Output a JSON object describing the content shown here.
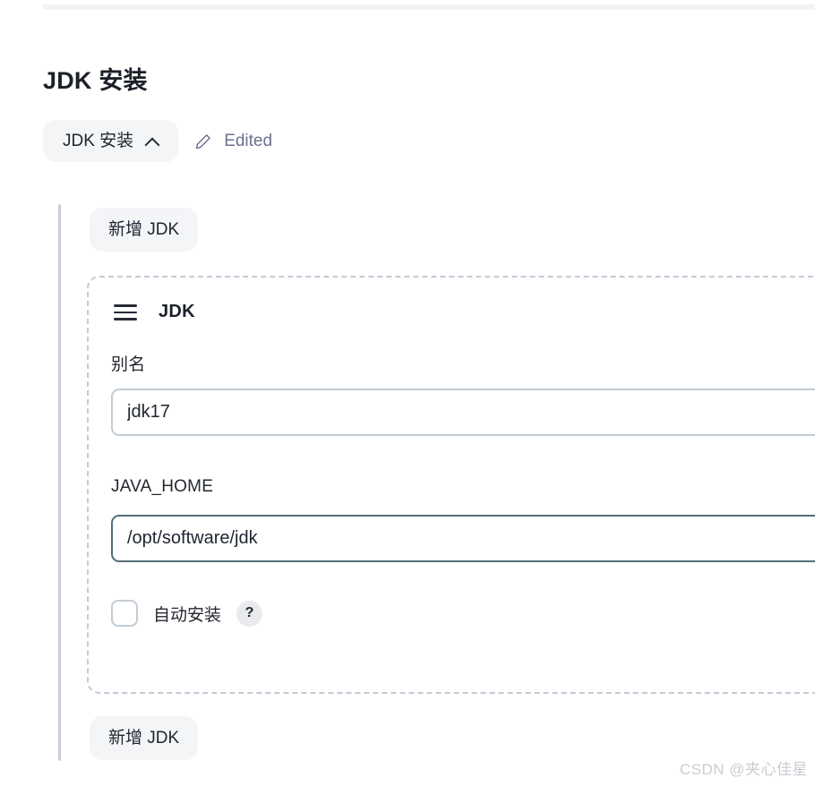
{
  "page": {
    "title": "JDK 安装"
  },
  "collapse": {
    "label": "JDK 安装",
    "chevron_icon": "chevron-up-icon",
    "edited_label": "Edited",
    "edit_icon": "pencil-icon"
  },
  "buttons": {
    "add_jdk_top": "新增 JDK",
    "add_jdk_bottom": "新增 JDK"
  },
  "card": {
    "drag_icon": "hamburger-drag-icon",
    "title": "JDK",
    "fields": [
      {
        "label": "别名",
        "value": "jdk17",
        "placeholder": "",
        "state": "idle"
      },
      {
        "label": "JAVA_HOME",
        "value": "/opt/software/jdk",
        "placeholder": "",
        "state": "focused"
      }
    ],
    "checkbox": {
      "label": "自动安装",
      "checked": false,
      "help_badge": "?"
    }
  },
  "watermark": "CSDN @夹心佳星",
  "colors": {
    "accent_border_focused": "#546e7a",
    "border_idle": "#c3ccd4",
    "dashed_border": "#c3cbd6",
    "pill_background": "#f4f5f7",
    "text_primary": "#1f2430",
    "text_muted": "#6b7190",
    "guide_line": "#c9cdd6",
    "watermark": "#c9ccd2"
  }
}
